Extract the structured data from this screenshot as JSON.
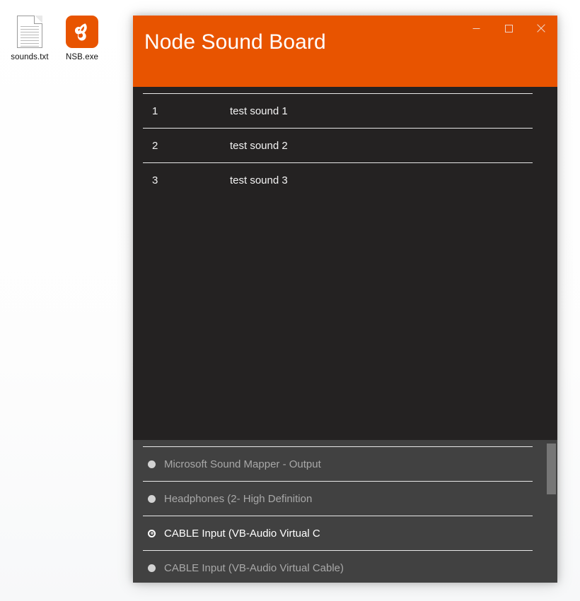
{
  "desktop": {
    "icons": [
      {
        "label": "sounds.txt",
        "type": "text-file"
      },
      {
        "label": "NSB.exe",
        "type": "application"
      }
    ]
  },
  "window": {
    "title": "Node Sound Board",
    "accent_color": "#E85400",
    "list_background": "#242222",
    "device_background": "#414141",
    "controls": {
      "minimize": "–",
      "maximize": "□",
      "close": "×"
    }
  },
  "sounds": [
    {
      "index": "1",
      "name": "test sound 1"
    },
    {
      "index": "2",
      "name": "test sound 2"
    },
    {
      "index": "3",
      "name": "test sound 3"
    }
  ],
  "devices": [
    {
      "name": "Microsoft Sound Mapper - Output",
      "selected": false
    },
    {
      "name": "Headphones (2- High Definition",
      "selected": false
    },
    {
      "name": "CABLE Input (VB-Audio Virtual C",
      "selected": true
    },
    {
      "name": "CABLE Input (VB-Audio Virtual Cable)",
      "selected": false
    }
  ]
}
